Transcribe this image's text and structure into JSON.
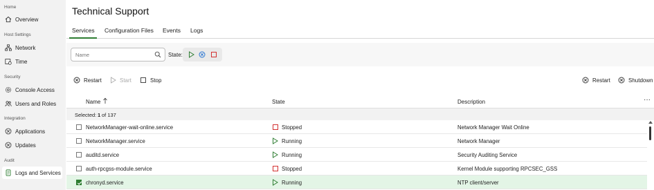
{
  "sidebar": {
    "sections": {
      "home": "Home",
      "host_settings": "Host Settings",
      "security": "Security",
      "integration": "Integration",
      "audit": "Audit"
    },
    "items": {
      "overview": "Overview",
      "network": "Network",
      "time": "Time",
      "console_access": "Console Access",
      "users_and_roles": "Users and Roles",
      "applications": "Applications",
      "updates": "Updates",
      "logs_and_services": "Logs and Services"
    }
  },
  "header": {
    "title": "Technical Support",
    "tabs": [
      "Services",
      "Configuration Files",
      "Events",
      "Logs"
    ],
    "active_tab": "Services"
  },
  "filter": {
    "search_placeholder": "Name",
    "state_label": "State:"
  },
  "toolbar": {
    "restart": "Restart",
    "start": "Start",
    "stop": "Stop",
    "host_restart": "Restart",
    "shutdown": "Shutdown"
  },
  "table": {
    "columns": {
      "name": "Name",
      "state": "State",
      "description": "Description"
    },
    "selected_label": "Selected:",
    "selected_count": "1",
    "selected_of": "of 137",
    "rows": [
      {
        "name": "NetworkManager-wait-online.service",
        "state": "Stopped",
        "description": "Network Manager Wait Online",
        "checked": false
      },
      {
        "name": "NetworkManager.service",
        "state": "Running",
        "description": "Network Manager",
        "checked": false
      },
      {
        "name": "auditd.service",
        "state": "Running",
        "description": "Security Auditing Service",
        "checked": false
      },
      {
        "name": "auth-rpcgss-module.service",
        "state": "Stopped",
        "description": "Kernel Module supporting RPCSEC_GSS",
        "checked": false
      },
      {
        "name": "chronyd.service",
        "state": "Running",
        "description": "NTP client/server",
        "checked": true
      }
    ]
  },
  "colors": {
    "accent": "#2e7d32",
    "running": "#2e7d32",
    "stopped": "#d32f2f",
    "paused": "#1e6fd1",
    "selected_row": "#e3f5e6"
  }
}
